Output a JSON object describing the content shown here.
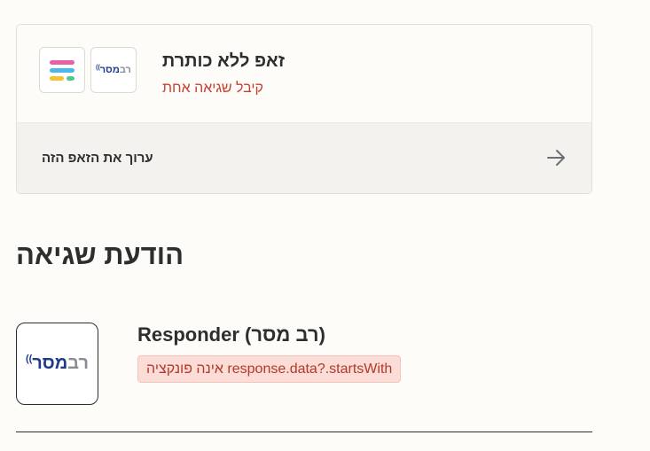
{
  "zap": {
    "title": "זאפ ללא כותרת",
    "status": "קיבל שגיאה אחת",
    "edit_label": "ערוך את הזאפ הזה",
    "apps": [
      {
        "name": "רב מסר",
        "icon": "ravmeser-logo"
      },
      {
        "name": "",
        "icon": "stacked-lines-logo"
      }
    ]
  },
  "error_section": {
    "title": "הודעת שגיאה",
    "step": {
      "app_logo": "רב מסר",
      "title": "Responder (רב מסר)",
      "error": "response.data?.startsWith אינה פונקציה"
    }
  },
  "colors": {
    "error_text": "#c7402e",
    "error_chip_bg": "#fbdcd6",
    "logo_blue": "#1e3a8c",
    "logo_gray": "#8a8d93",
    "bar_pink": "#e85fa8",
    "bar_blue": "#4cb8ea",
    "bar_yellow": "#f5c331",
    "bar_green": "#4fc98c"
  }
}
